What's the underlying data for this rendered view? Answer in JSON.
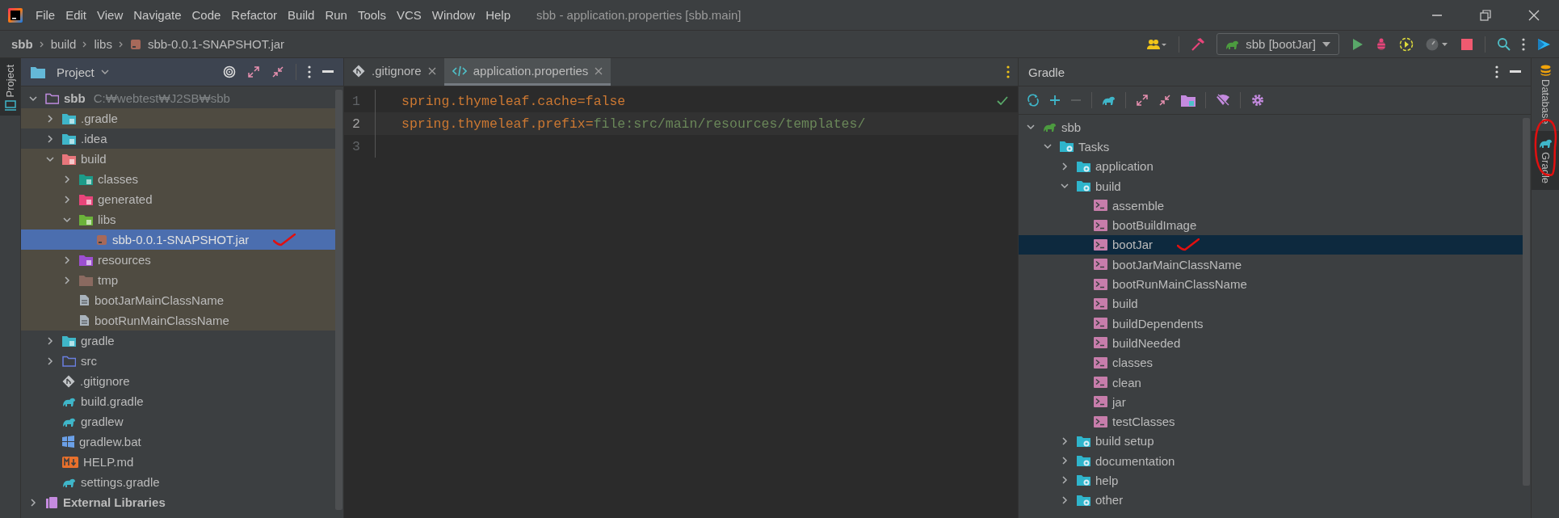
{
  "window": {
    "title": "sbb - application.properties [sbb.main]"
  },
  "menu": [
    "File",
    "Edit",
    "View",
    "Navigate",
    "Code",
    "Refactor",
    "Build",
    "Run",
    "Tools",
    "VCS",
    "Window",
    "Help"
  ],
  "breadcrumbs": [
    {
      "label": "sbb",
      "kind": "project"
    },
    {
      "label": "build",
      "kind": "folder"
    },
    {
      "label": "libs",
      "kind": "folder"
    },
    {
      "label": "sbb-0.0.1-SNAPSHOT.jar",
      "kind": "jar"
    }
  ],
  "run_config": {
    "label": "sbb [bootJar]"
  },
  "left_stripe": [
    {
      "label": "Project",
      "selected": true
    }
  ],
  "project": {
    "title": "Project",
    "tree": [
      {
        "label": "sbb",
        "hint": "C:₩webtest₩J2SB₩sbb",
        "kind": "project-folder",
        "expanded": true,
        "selected": false,
        "excluded": false,
        "children": [
          {
            "label": ".gradle",
            "kind": "gradle-folder",
            "expanded": false,
            "selected": false,
            "excluded": true
          },
          {
            "label": ".idea",
            "kind": "idea-folder",
            "expanded": false,
            "selected": false,
            "excluded": false
          },
          {
            "label": "build",
            "kind": "build-folder",
            "expanded": true,
            "selected": false,
            "excluded": true,
            "children": [
              {
                "label": "classes",
                "kind": "classes-folder",
                "expanded": false,
                "selected": false,
                "excluded": true
              },
              {
                "label": "generated",
                "kind": "generated-folder",
                "expanded": false,
                "selected": false,
                "excluded": true
              },
              {
                "label": "libs",
                "kind": "libs-folder",
                "expanded": true,
                "selected": false,
                "excluded": true,
                "children": [
                  {
                    "label": "sbb-0.0.1-SNAPSHOT.jar",
                    "kind": "jar",
                    "selected": true,
                    "marked": true
                  }
                ]
              },
              {
                "label": "resources",
                "kind": "resources-folder",
                "expanded": false,
                "selected": false,
                "excluded": true
              },
              {
                "label": "tmp",
                "kind": "tmp-folder",
                "expanded": false,
                "selected": false,
                "excluded": true
              },
              {
                "label": "bootJarMainClassName",
                "kind": "text-file",
                "selected": false,
                "excluded": true
              },
              {
                "label": "bootRunMainClassName",
                "kind": "text-file",
                "selected": false,
                "excluded": true
              }
            ]
          },
          {
            "label": "gradle",
            "kind": "gradle-folder",
            "expanded": false,
            "selected": false,
            "excluded": false
          },
          {
            "label": "src",
            "kind": "source-folder",
            "expanded": false,
            "selected": false,
            "excluded": false
          },
          {
            "label": ".gitignore",
            "kind": "git-file",
            "selected": false,
            "excluded": false
          },
          {
            "label": "build.gradle",
            "kind": "gradle-file",
            "selected": false,
            "excluded": false
          },
          {
            "label": "gradlew",
            "kind": "gradle-file",
            "selected": false,
            "excluded": false
          },
          {
            "label": "gradlew.bat",
            "kind": "batch-file",
            "selected": false,
            "excluded": false
          },
          {
            "label": "HELP.md",
            "kind": "markdown-file",
            "selected": false,
            "excluded": false
          },
          {
            "label": "settings.gradle",
            "kind": "gradle-file",
            "selected": false,
            "excluded": false
          }
        ]
      },
      {
        "label": "External Libraries",
        "kind": "library",
        "expanded": false,
        "selected": false,
        "excluded": false
      }
    ]
  },
  "editor": {
    "tabs": [
      {
        "label": ".gitignore",
        "kind": "git",
        "selected": false
      },
      {
        "label": "application.properties",
        "kind": "properties",
        "selected": true
      }
    ],
    "lines": [
      {
        "number": "1",
        "current": false,
        "tokens": [
          {
            "kind": "key",
            "text": "spring.thymeleaf.cache"
          },
          {
            "kind": "separator",
            "text": "="
          },
          {
            "kind": "keyword",
            "text": "false"
          }
        ]
      },
      {
        "number": "2",
        "current": true,
        "tokens": [
          {
            "kind": "key",
            "text": "spring.thymeleaf.prefix"
          },
          {
            "kind": "separator",
            "text": "="
          },
          {
            "kind": "string",
            "text": "file:src/main/resources/templates/"
          }
        ]
      },
      {
        "number": "3",
        "current": false
      }
    ]
  },
  "gradle": {
    "title": "Gradle",
    "tree": [
      {
        "label": "sbb",
        "kind": "gradle-project",
        "expanded": true,
        "selected": false,
        "children": [
          {
            "label": "Tasks",
            "kind": "task-folder",
            "expanded": true,
            "selected": false,
            "children": [
              {
                "label": "application",
                "kind": "task-folder",
                "expanded": false,
                "selected": false
              },
              {
                "label": "build",
                "kind": "task-folder",
                "expanded": true,
                "selected": false,
                "children": [
                  {
                    "label": "assemble",
                    "kind": "task",
                    "selected": false
                  },
                  {
                    "label": "bootBuildImage",
                    "kind": "task",
                    "selected": false
                  },
                  {
                    "label": "bootJar",
                    "kind": "task",
                    "selected": true,
                    "marked": true
                  },
                  {
                    "label": "bootJarMainClassName",
                    "kind": "task",
                    "selected": false
                  },
                  {
                    "label": "bootRunMainClassName",
                    "kind": "task",
                    "selected": false
                  },
                  {
                    "label": "build",
                    "kind": "task",
                    "selected": false
                  },
                  {
                    "label": "buildDependents",
                    "kind": "task",
                    "selected": false
                  },
                  {
                    "label": "buildNeeded",
                    "kind": "task",
                    "selected": false
                  },
                  {
                    "label": "classes",
                    "kind": "task",
                    "selected": false
                  },
                  {
                    "label": "clean",
                    "kind": "task",
                    "selected": false
                  },
                  {
                    "label": "jar",
                    "kind": "task",
                    "selected": false
                  },
                  {
                    "label": "testClasses",
                    "kind": "task",
                    "selected": false
                  }
                ]
              },
              {
                "label": "build setup",
                "kind": "task-folder",
                "expanded": false,
                "selected": false
              },
              {
                "label": "documentation",
                "kind": "task-folder",
                "expanded": false,
                "selected": false
              },
              {
                "label": "help",
                "kind": "task-folder",
                "expanded": false,
                "selected": false
              },
              {
                "label": "other",
                "kind": "task-folder",
                "expanded": false,
                "selected": false
              }
            ]
          }
        ]
      }
    ]
  },
  "right_stripe": [
    {
      "label": "Database",
      "kind": "database",
      "selected": false
    },
    {
      "label": "Gradle",
      "kind": "gradle",
      "selected": true,
      "circled": true
    }
  ]
}
